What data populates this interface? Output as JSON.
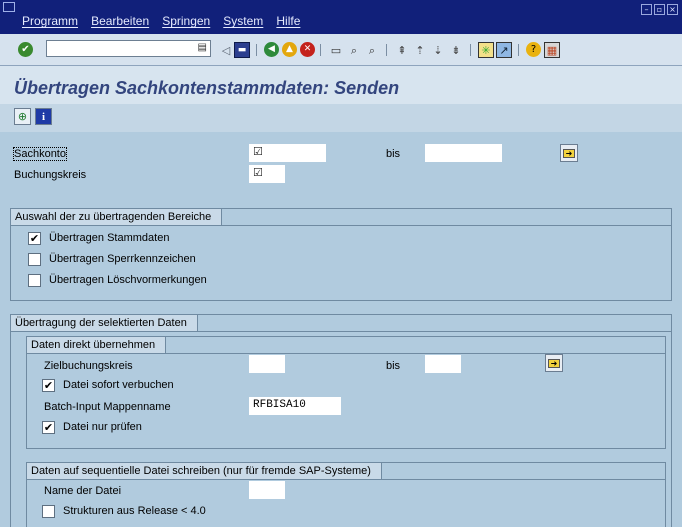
{
  "menubar": {
    "items": [
      "Programm",
      "Bearbeiten",
      "Springen",
      "System",
      "Hilfe"
    ]
  },
  "window_controls": [
    "minimize-icon",
    "maximize-icon",
    "close-icon"
  ],
  "toolbar": {
    "command_field_value": "",
    "icons": [
      "enter-icon",
      "back-arrow-icon",
      "save-icon",
      "back-icon",
      "exit-icon",
      "cancel-icon",
      "print-icon",
      "find-icon",
      "find-next-icon",
      "first-page-icon",
      "previous-page-icon",
      "next-page-icon",
      "last-page-icon",
      "create-session-icon",
      "shortcut-icon",
      "help-icon",
      "layout-menu-icon"
    ]
  },
  "page": {
    "title": "Übertragen Sachkontenstammdaten: Senden"
  },
  "app_toolbar": {
    "buttons": [
      "execute-icon",
      "info-icon"
    ]
  },
  "selection": {
    "sachkonto_label": "Sachkonto",
    "sachkonto_from": "",
    "sachkonto_to": "",
    "bis_label": "bis",
    "buchungskreis_label": "Buchungskreis",
    "buchungskreis_value": ""
  },
  "bereiche": {
    "title": "Auswahl der zu übertragenden Bereiche",
    "options": [
      {
        "label": "Übertragen Stammdaten",
        "checked": true
      },
      {
        "label": "Übertragen Sperrkennzeichen",
        "checked": false
      },
      {
        "label": "Übertragen Löschvormerkungen",
        "checked": false
      }
    ]
  },
  "uebertragung": {
    "title": "Übertragung der selektierten Daten",
    "direkt": {
      "title": "Daten direkt übernehmen",
      "zielbuchungskreis_label": "Zielbuchungskreis",
      "zielbuchungskreis_from": "",
      "zielbuchungskreis_to": "",
      "bis_label": "bis",
      "sofort_verbuchen_label": "Datei sofort verbuchen",
      "sofort_verbuchen_checked": true,
      "mappenname_label": "Batch-Input Mappenname",
      "mappenname_value": "RFBISA10",
      "nur_pruefen_label": "Datei nur prüfen",
      "nur_pruefen_checked": true
    },
    "sequentiell": {
      "title": "Daten auf sequentielle Datei schreiben (nur für fremde SAP-Systeme)",
      "dateiname_label": "Name der Datei",
      "dateiname_value": "",
      "strukturen_label": "Strukturen aus Release < 4.0",
      "strukturen_checked": false
    }
  }
}
